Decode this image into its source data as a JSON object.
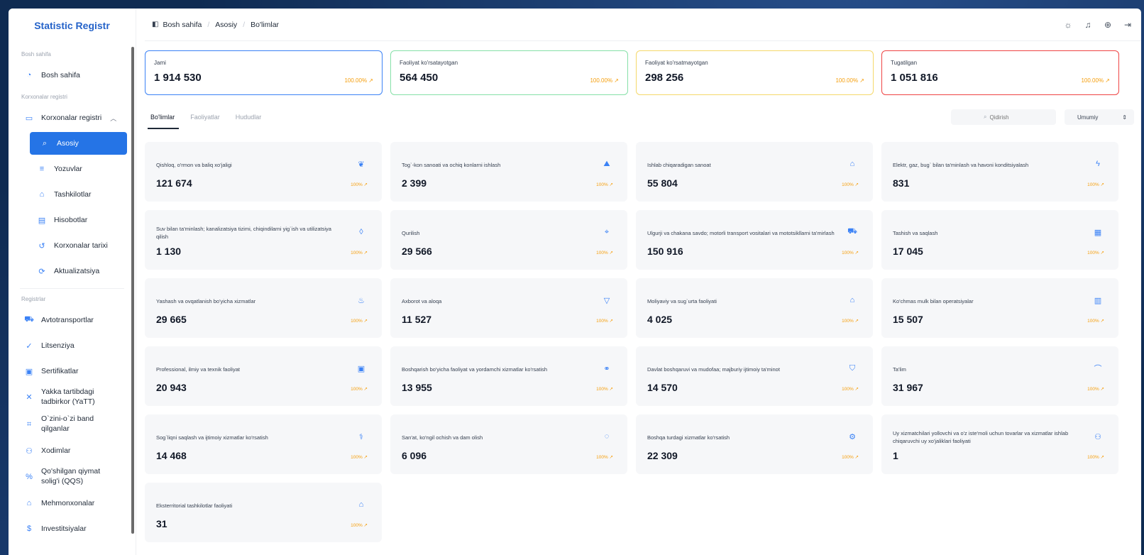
{
  "brand": "Statistic Registr",
  "sidebar": {
    "sections": [
      {
        "title": "Bosh sahifa",
        "items": [
          {
            "label": "Bosh sahifa",
            "icon": "dashboard-icon"
          }
        ]
      },
      {
        "title": "Korxonalar registri",
        "items": [
          {
            "label": "Korxonalar registri",
            "icon": "folder-icon"
          },
          {
            "label": "Asosiy",
            "icon": "search-icon"
          },
          {
            "label": "Yozuvlar",
            "icon": "list-icon"
          },
          {
            "label": "Tashkilotlar",
            "icon": "building-icon"
          },
          {
            "label": "Hisobotlar",
            "icon": "report-icon"
          },
          {
            "label": "Korxonalar tarixi",
            "icon": "history-icon"
          },
          {
            "label": "Aktualizatsiya",
            "icon": "refresh-icon"
          }
        ]
      },
      {
        "title": "Registrlar",
        "items": [
          {
            "label": "Avtotransportlar",
            "icon": "car-icon"
          },
          {
            "label": "Litsenziya",
            "icon": "check-circle-icon"
          },
          {
            "label": "Sertifikatlar",
            "icon": "certificate-icon"
          },
          {
            "label": "Yakka tartibdagi tadbirkor (YaTT)",
            "icon": "person-icon"
          },
          {
            "label": "O`zini-o`zi band qilganlar",
            "icon": "user-scan-icon"
          },
          {
            "label": "Xodimlar",
            "icon": "people-icon"
          },
          {
            "label": "Qo'shilgan qiymat solig'i (QQS)",
            "icon": "percent-icon"
          },
          {
            "label": "Mehmonxonalar",
            "icon": "hotel-icon"
          },
          {
            "label": "Investitsiyalar",
            "icon": "dollar-icon"
          }
        ]
      }
    ]
  },
  "breadcrumb": [
    "Bosh sahifa",
    "Asosiy",
    "Bo'limlar"
  ],
  "stats": [
    {
      "label": "Jami",
      "value": "1 914 530",
      "pct": "100.00%",
      "color": "#3b82f6"
    },
    {
      "label": "Faoliyat ko'rsatayotgan",
      "value": "564 450",
      "pct": "100.00%",
      "color": "#86e0a8"
    },
    {
      "label": "Faoliyat ko'rsatmayotgan",
      "value": "298 256",
      "pct": "100.00%",
      "color": "#f5d86b"
    },
    {
      "label": "Tugatilgan",
      "value": "1 051 816",
      "pct": "100.00%",
      "color": "#ef4444"
    }
  ],
  "tabs": [
    "Bo'limlar",
    "Faoliyatlar",
    "Hududlar"
  ],
  "search": {
    "placeholder": "Qidirish"
  },
  "select": {
    "value": "Umumiy"
  },
  "cards": [
    {
      "title": "Qishloq, o'rmon va baliq xo'jaligi",
      "value": "121 674",
      "pct": "100%",
      "icon": "plant-icon"
    },
    {
      "title": "Tog`-kon sanoati va ochiq konlarni ishlash",
      "value": "2 399",
      "pct": "100%",
      "icon": "mountain-icon"
    },
    {
      "title": "Ishlab chiqaradigan sanoat",
      "value": "55 804",
      "pct": "100%",
      "icon": "factory-icon"
    },
    {
      "title": "Elektr, gaz, bug` bilan ta'minlash va havoni konditsiyalash",
      "value": "831",
      "pct": "100%",
      "icon": "bolt-icon"
    },
    {
      "title": "Suv bilan ta'minlash; kanalizatsiya tizimi, chiqindilarni yig`ish va utilizatsiya qilish",
      "value": "1 130",
      "pct": "100%",
      "icon": "droplet-icon"
    },
    {
      "title": "Qurilish",
      "value": "29 566",
      "pct": "100%",
      "icon": "crane-icon"
    },
    {
      "title": "Ulgurji va chakana savdo; motorli transport vositalari va mototsikllarni ta'mirlash",
      "value": "150 916",
      "pct": "100%",
      "icon": "car-icon"
    },
    {
      "title": "Tashish va saqlash",
      "value": "17 045",
      "pct": "100%",
      "icon": "warehouse-icon"
    },
    {
      "title": "Yashash va ovqatlanish bo'yicha xizmatlar",
      "value": "29 665",
      "pct": "100%",
      "icon": "pot-icon"
    },
    {
      "title": "Axborot va aloqa",
      "value": "11 527",
      "pct": "100%",
      "icon": "signal-icon"
    },
    {
      "title": "Moliyaviy va sug`urta faoliyati",
      "value": "4 025",
      "pct": "100%",
      "icon": "bank-icon"
    },
    {
      "title": "Ko'chmas mulk bilan operatsiyalar",
      "value": "15 507",
      "pct": "100%",
      "icon": "building-icon"
    },
    {
      "title": "Professional, ilmiy va texnik faoliyat",
      "value": "20 943",
      "pct": "100%",
      "icon": "briefcase-icon"
    },
    {
      "title": "Boshqarish bo'yicha faoliyat va yordamchi xizmatlar ko'rsatish",
      "value": "13 955",
      "pct": "100%",
      "icon": "handshake-icon"
    },
    {
      "title": "Davlat boshqaruvi va mudofaa; majburiy ijtimoiy ta'minot",
      "value": "14 570",
      "pct": "100%",
      "icon": "shield-icon"
    },
    {
      "title": "Ta'lim",
      "value": "31 967",
      "pct": "100%",
      "icon": "graduation-cap-icon"
    },
    {
      "title": "Sog`liqni saqlash va ijtimoiy xizmatlar ko'rsatish",
      "value": "14 468",
      "pct": "100%",
      "icon": "stethoscope-icon"
    },
    {
      "title": "San'at, ko'ngil ochish va dam olish",
      "value": "6 096",
      "pct": "100%",
      "icon": "palette-icon"
    },
    {
      "title": "Boshqa turdagi xizmatlar ko'rsatish",
      "value": "22 309",
      "pct": "100%",
      "icon": "gear-icon"
    },
    {
      "title": "Uy xizmatchilari yollovchi va o'z iste'moli uchun tovarlar va xizmatlar ishlab chiqaruvchi uy xo'jaliklari faoliyati",
      "value": "1",
      "pct": "100%",
      "icon": "people-icon"
    },
    {
      "title": "Eksterritorial tashkilotlar faoliyati",
      "value": "31",
      "pct": "100%",
      "icon": "globe-home-icon"
    }
  ]
}
